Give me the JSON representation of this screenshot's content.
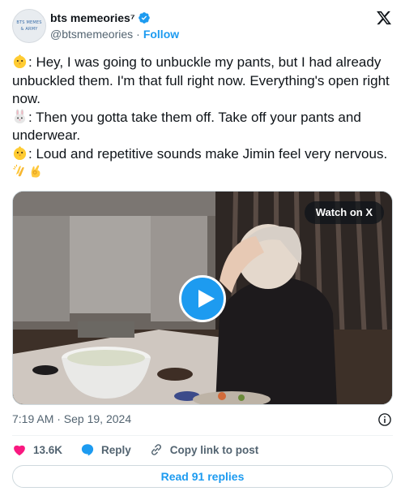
{
  "account": {
    "display_name": "bts memeories⁷",
    "handle": "@btsmemeories",
    "separator": "·",
    "follow_label": "Follow",
    "avatar_text_line1": "BTS MEMES",
    "avatar_text_line2": "& ARMY",
    "verified": true
  },
  "tweet": {
    "lines": [
      {
        "emoji": "chick-emoji",
        "text": ": Hey, I was going to unbuckle my pants, but I had already unbuckled them. I'm that full right now. Everything's open right now."
      },
      {
        "emoji": "rabbit-emoji",
        "text": ": Then you gotta take them off. Take off your pants and underwear."
      },
      {
        "emoji": "chick-emoji",
        "text": ": Loud and repetitive sounds make Jimin feel very nervous."
      }
    ],
    "trailing_emojis": [
      "clapping-hands-emoji",
      "ok-hand-emoji"
    ]
  },
  "media": {
    "watch_label": "Watch on X",
    "icons": {
      "play": "play-icon"
    }
  },
  "meta": {
    "timestamp": "7:19 AM · Sep 19, 2024"
  },
  "actions": {
    "like_count": "13.6K",
    "reply_label": "Reply",
    "copy_label": "Copy link to post"
  },
  "replies_label": "Read 91 replies",
  "colors": {
    "accent": "#1d9bf0",
    "like": "#f91880",
    "text": "#0f1419",
    "muted": "#536471",
    "border": "#cfd9de"
  }
}
